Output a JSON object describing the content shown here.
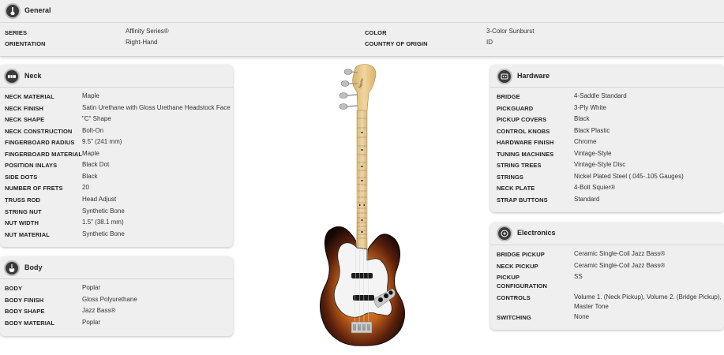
{
  "general": {
    "title": "General",
    "left": [
      {
        "label": "SERIES",
        "value": "Affinity Series®"
      },
      {
        "label": "ORIENTATION",
        "value": "Right-Hand"
      }
    ],
    "right": [
      {
        "label": "COLOR",
        "value": "3-Color Sunburst"
      },
      {
        "label": "COUNTRY OF ORIGIN",
        "value": "ID"
      }
    ]
  },
  "neck": {
    "title": "Neck",
    "rows": [
      {
        "label": "NECK MATERIAL",
        "value": "Maple"
      },
      {
        "label": "NECK FINISH",
        "value": "Satin Urethane with Gloss Urethane Headstock Face"
      },
      {
        "label": "NECK SHAPE",
        "value": "\"C\" Shape"
      },
      {
        "label": "NECK CONSTRUCTION",
        "value": "Bolt-On"
      },
      {
        "label": "FINGERBOARD RADIUS",
        "value": "9.5\" (241 mm)"
      },
      {
        "label": "FINGERBOARD MATERIAL",
        "value": "Maple"
      },
      {
        "label": "POSITION INLAYS",
        "value": "Black Dot"
      },
      {
        "label": "SIDE DOTS",
        "value": "Black"
      },
      {
        "label": "NUMBER OF FRETS",
        "value": "20"
      },
      {
        "label": "TRUSS ROD",
        "value": "Head Adjust"
      },
      {
        "label": "STRING NUT",
        "value": "Synthetic Bone"
      },
      {
        "label": "NUT WIDTH",
        "value": "1.5\" (38.1 mm)"
      },
      {
        "label": "NUT MATERIAL",
        "value": "Synthetic Bone"
      }
    ]
  },
  "body": {
    "title": "Body",
    "rows": [
      {
        "label": "BODY",
        "value": "Poplar"
      },
      {
        "label": "BODY FINISH",
        "value": "Gloss Polyurethane"
      },
      {
        "label": "BODY SHAPE",
        "value": "Jazz Bass®"
      },
      {
        "label": "BODY MATERIAL",
        "value": "Poplar"
      }
    ]
  },
  "hardware": {
    "title": "Hardware",
    "rows": [
      {
        "label": "BRIDGE",
        "value": "4-Saddle Standard"
      },
      {
        "label": "PICKGUARD",
        "value": "3-Ply White"
      },
      {
        "label": "PICKUP COVERS",
        "value": "Black"
      },
      {
        "label": "CONTROL KNOBS",
        "value": "Black Plastic"
      },
      {
        "label": "HARDWARE FINISH",
        "value": "Chrome"
      },
      {
        "label": "TUNING MACHINES",
        "value": "Vintage-Style"
      },
      {
        "label": "STRING TREES",
        "value": "Vintage-Style Disc"
      },
      {
        "label": "STRINGS",
        "value": "Nickel Plated Steel (.045-.105 Gauges)"
      },
      {
        "label": "NECK PLATE",
        "value": "4-Bolt Squier®"
      },
      {
        "label": "STRAP BUTTONS",
        "value": "Standard"
      }
    ]
  },
  "electronics": {
    "title": "Electronics",
    "rows": [
      {
        "label": "BRIDGE PICKUP",
        "value": "Ceramic Single-Coil Jazz Bass®"
      },
      {
        "label": "NECK PICKUP",
        "value": "Ceramic Single-Coil Jazz Bass®"
      },
      {
        "label_line1": "PICKUP",
        "label_line2": "CONFIGURATION",
        "value": "SS"
      },
      {
        "label": "CONTROLS",
        "value_line1": "Volume 1. (Neck Pickup), Volume 2. (Bridge Pickup),",
        "value_line2": "Master Tone"
      },
      {
        "label": "SWITCHING",
        "value": "None"
      }
    ]
  },
  "icons": {
    "general": "guitar-icon",
    "neck": "neck-icon",
    "body": "body-icon",
    "hardware": "hardware-icon",
    "electronics": "electronics-icon"
  },
  "colors": {
    "panel_bg": "#efefef",
    "icon_bg": "#3a3a3a",
    "guitar_sunburst_edge": "#1a0d08",
    "guitar_sunburst_center": "#d98a25",
    "maple": "#e8c98a"
  }
}
